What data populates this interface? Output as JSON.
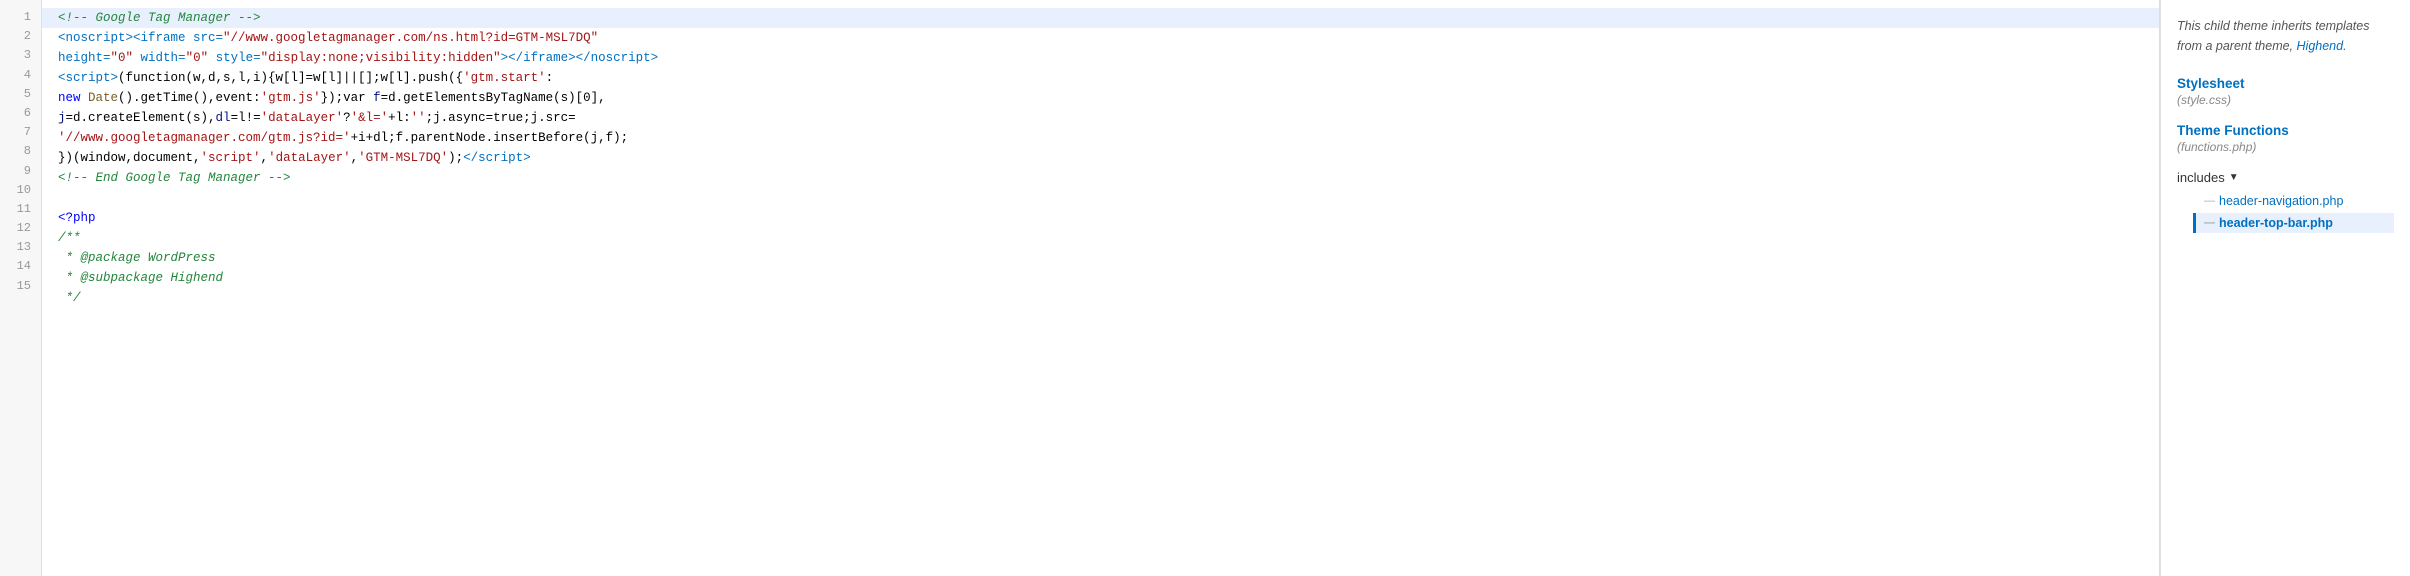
{
  "sidebar": {
    "description": "This child theme inherits templates from a parent theme, ",
    "parent_theme_link": "Highend.",
    "stylesheet_label": "Stylesheet",
    "stylesheet_file": "(style.css)",
    "theme_functions_label": "Theme Functions",
    "theme_functions_file": "(functions.php)",
    "folder_label": "includes",
    "files": [
      {
        "name": "header-navigation.php",
        "active": false,
        "prefix": "—"
      },
      {
        "name": "header-top-bar.php",
        "active": true,
        "prefix": "—"
      }
    ]
  },
  "line_numbers": [
    1,
    2,
    3,
    4,
    5,
    6,
    7,
    8,
    9,
    10,
    11,
    12,
    13,
    14,
    15
  ]
}
